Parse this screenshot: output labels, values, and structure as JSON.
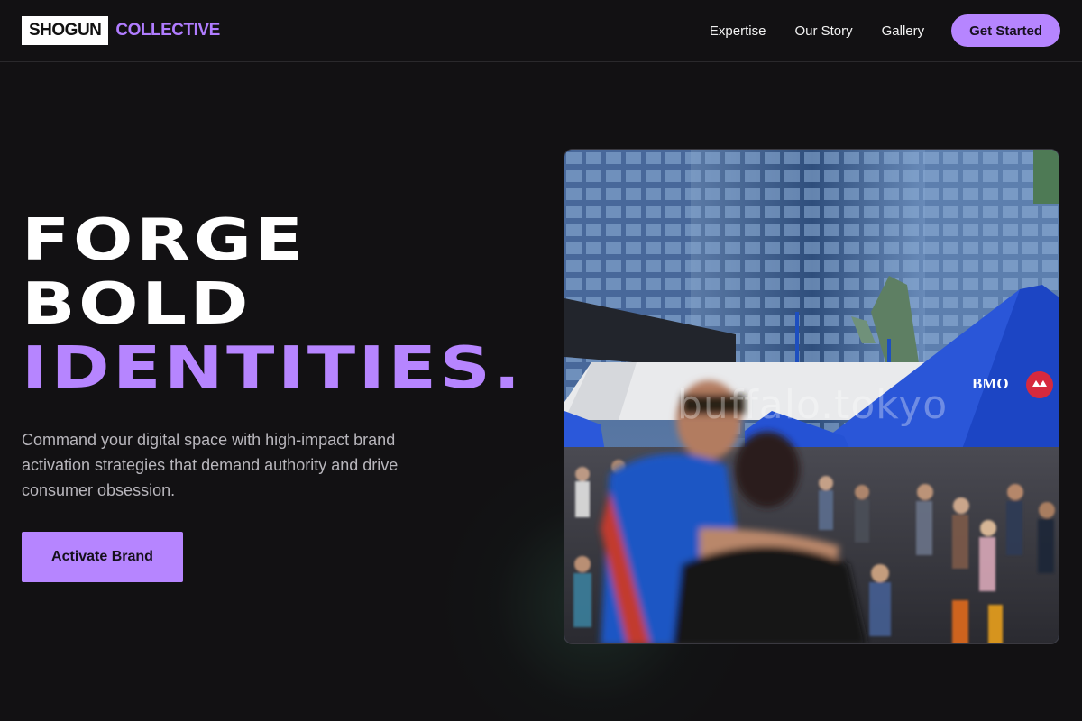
{
  "brand": {
    "badge": "SHOGUN",
    "word": "COLLECTIVE"
  },
  "nav": {
    "links": [
      "Expertise",
      "Our Story",
      "Gallery"
    ],
    "cta": "Get Started"
  },
  "hero": {
    "headline": [
      "FORGE",
      "BOLD",
      "IDENTITIES."
    ],
    "subtext": "Command your digital space with high-impact brand activation strategies that demand authority and drive consumer obsession.",
    "button": "Activate Brand"
  },
  "photo": {
    "watermark": "buffalo.tokyo",
    "tent_label": "BMO",
    "tent_logo": "BMO emblem"
  },
  "colors": {
    "background": "#121113",
    "accent": "#b685ff",
    "text": "#ffffff",
    "muted_text": "#b8b6bc"
  }
}
